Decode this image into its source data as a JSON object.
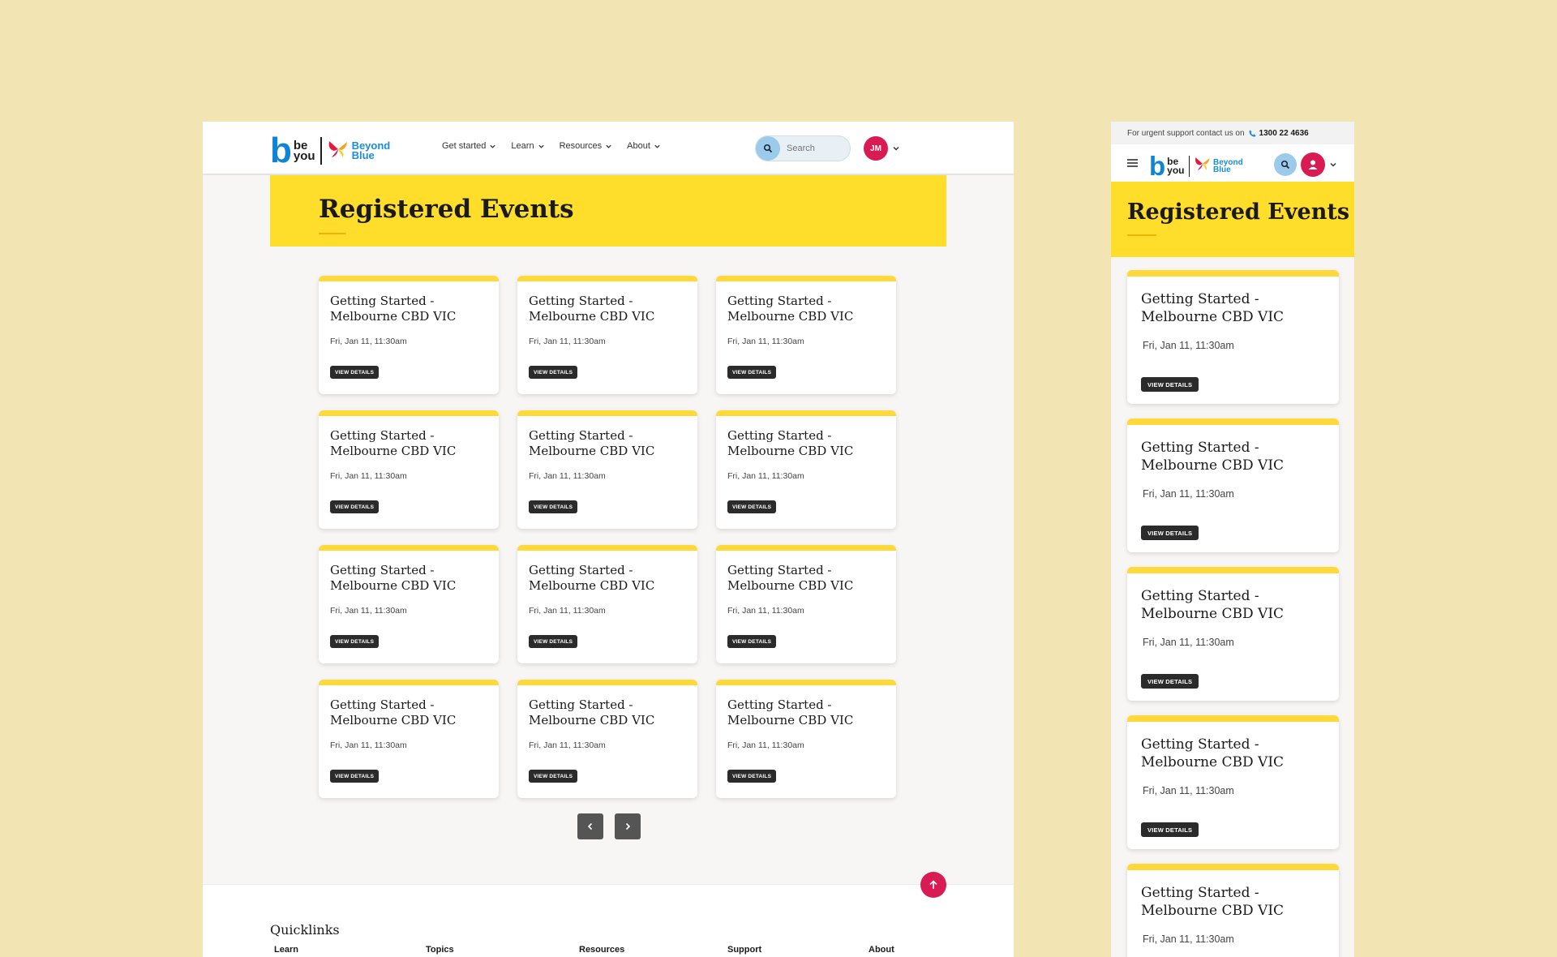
{
  "desktop": {
    "logo": {
      "be": "be",
      "you": "you",
      "partner_line1": "Beyond",
      "partner_line2": "Blue"
    },
    "nav": [
      {
        "label": "Get started"
      },
      {
        "label": "Learn"
      },
      {
        "label": "Resources"
      },
      {
        "label": "About"
      }
    ],
    "search": {
      "placeholder": "Search"
    },
    "avatar": {
      "initials": "JM"
    },
    "page_title": "Registered Events",
    "events": [
      {
        "title": "Getting Started - Melbourne CBD VIC",
        "date": "Fri, Jan 11, 11:30am",
        "button": "VIEW DETAILS"
      },
      {
        "title": "Getting Started - Melbourne CBD VIC",
        "date": "Fri, Jan 11, 11:30am",
        "button": "VIEW DETAILS"
      },
      {
        "title": "Getting Started - Melbourne CBD VIC",
        "date": "Fri, Jan 11, 11:30am",
        "button": "VIEW DETAILS"
      },
      {
        "title": "Getting Started - Melbourne CBD VIC",
        "date": "Fri, Jan 11, 11:30am",
        "button": "VIEW DETAILS"
      },
      {
        "title": "Getting Started - Melbourne CBD VIC",
        "date": "Fri, Jan 11, 11:30am",
        "button": "VIEW DETAILS"
      },
      {
        "title": "Getting Started - Melbourne CBD VIC",
        "date": "Fri, Jan 11, 11:30am",
        "button": "VIEW DETAILS"
      },
      {
        "title": "Getting Started - Melbourne CBD VIC",
        "date": "Fri, Jan 11, 11:30am",
        "button": "VIEW DETAILS"
      },
      {
        "title": "Getting Started - Melbourne CBD VIC",
        "date": "Fri, Jan 11, 11:30am",
        "button": "VIEW DETAILS"
      },
      {
        "title": "Getting Started - Melbourne CBD VIC",
        "date": "Fri, Jan 11, 11:30am",
        "button": "VIEW DETAILS"
      },
      {
        "title": "Getting Started - Melbourne CBD VIC",
        "date": "Fri, Jan 11, 11:30am",
        "button": "VIEW DETAILS"
      },
      {
        "title": "Getting Started - Melbourne CBD VIC",
        "date": "Fri, Jan 11, 11:30am",
        "button": "VIEW DETAILS"
      },
      {
        "title": "Getting Started - Melbourne CBD VIC",
        "date": "Fri, Jan 11, 11:30am",
        "button": "VIEW DETAILS"
      }
    ],
    "pagination": {
      "prev_icon": "chevron-left-icon",
      "next_icon": "chevron-right-icon"
    },
    "footer": {
      "quicklinks_title": "Quicklinks",
      "columns": [
        "Learn",
        "Topics",
        "Resources",
        "Support",
        "About"
      ]
    }
  },
  "mobile": {
    "alert": {
      "text": "For urgent support contact us on",
      "phone": "1300 22 4636"
    },
    "logo": {
      "be": "be",
      "you": "you",
      "partner_line1": "Beyond",
      "partner_line2": "Blue"
    },
    "page_title": "Registered Events",
    "events": [
      {
        "title": "Getting Started - Melbourne CBD VIC",
        "date": "Fri, Jan 11, 11:30am",
        "button": "VIEW DETAILS"
      },
      {
        "title": "Getting Started - Melbourne CBD VIC",
        "date": "Fri, Jan 11, 11:30am",
        "button": "VIEW DETAILS"
      },
      {
        "title": "Getting Started - Melbourne CBD VIC",
        "date": "Fri, Jan 11, 11:30am",
        "button": "VIEW DETAILS"
      },
      {
        "title": "Getting Started - Melbourne CBD VIC",
        "date": "Fri, Jan 11, 11:30am",
        "button": "VIEW DETAILS"
      },
      {
        "title": "Getting Started - Melbourne CBD VIC",
        "date": "Fri, Jan 11, 11:30am"
      }
    ]
  },
  "colors": {
    "background": "#f2e4b3",
    "accent_yellow": "#ffde2b",
    "brand_blue": "#0d84d4",
    "brand_pink": "#d81b52",
    "button_dark": "#2b2b2b"
  }
}
